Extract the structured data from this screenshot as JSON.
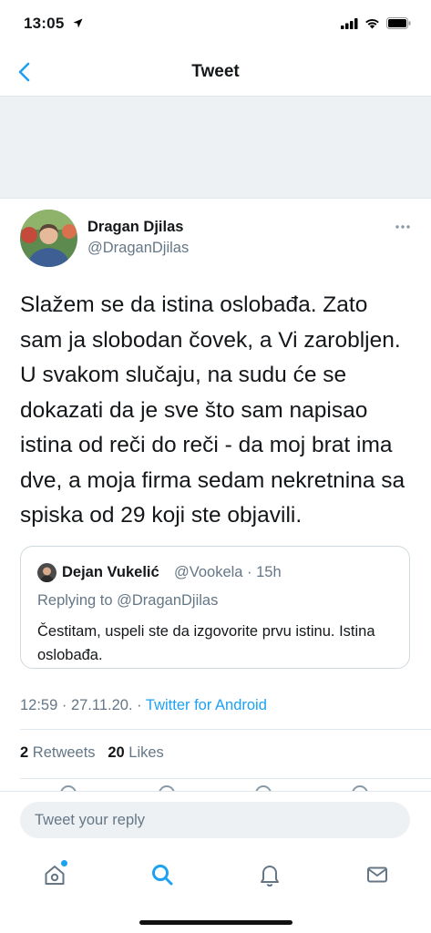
{
  "status_bar": {
    "time": "13:05"
  },
  "nav": {
    "title": "Tweet"
  },
  "tweet": {
    "author_name": "Dragan Djilas",
    "author_handle": "@DraganDjilas",
    "text": "Slažem se da istina oslobađa. Zato sam ja slobodan čovek, a Vi zarobljen. U svakom slučaju, na sudu će se dokazati da je sve što sam napisao istina od reči do reči - da moj brat ima dve, a moja firma sedam nekretnina sa spiska od 29 koji ste objavili.",
    "quoted": {
      "author_name": "Dejan Vukelić",
      "author_handle": "@Vookela · 15h",
      "replying_to": "Replying to @DraganDjilas",
      "text": "Čestitam, uspeli ste da izgovorite prvu istinu. Istina oslobađa."
    },
    "time_date": "12:59 · 27.11.20. · ",
    "source": "Twitter for Android",
    "retweets_count": "2",
    "retweets_label": "Retweets",
    "likes_count": "20",
    "likes_label": "Likes"
  },
  "reply": {
    "placeholder": "Tweet your reply"
  },
  "colors": {
    "accent": "#1da1f2",
    "secondary_text": "#657786",
    "border": "#e1e8ed"
  },
  "tabbar": {
    "icons": [
      "home-icon",
      "search-icon",
      "notifications-icon",
      "messages-icon"
    ]
  }
}
